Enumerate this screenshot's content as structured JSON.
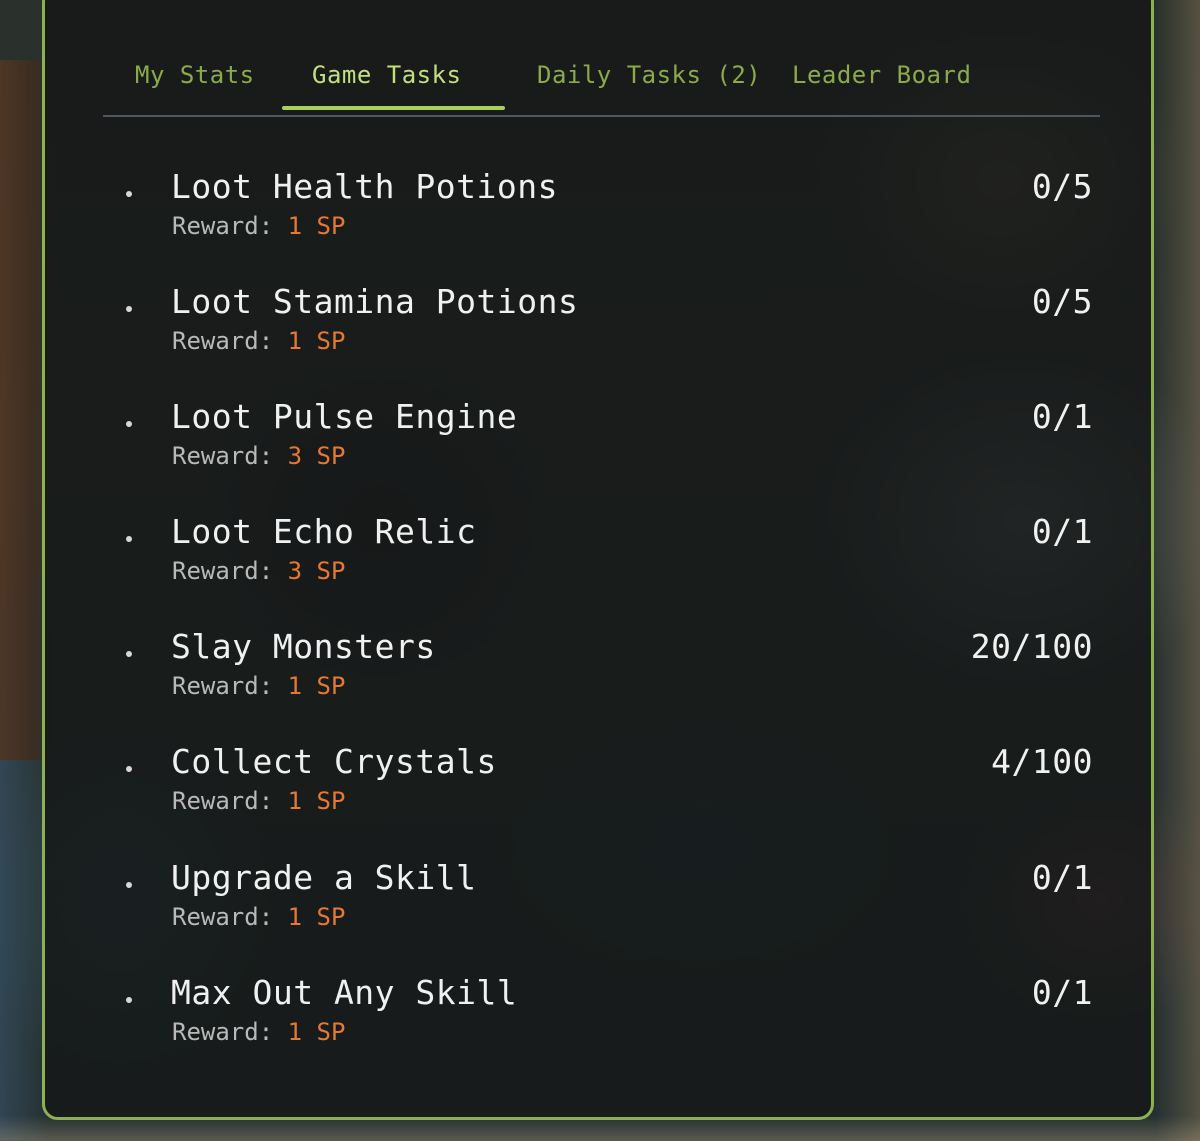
{
  "tabs": [
    {
      "label": "My Stats",
      "active": false
    },
    {
      "label": "Game Tasks",
      "active": true
    },
    {
      "label": "Daily Tasks (2)",
      "active": false
    },
    {
      "label": "Leader Board",
      "active": false
    }
  ],
  "reward_label": "Reward:",
  "tasks": [
    {
      "title": "Loot Health Potions",
      "reward": "1 SP",
      "progress": "0/5"
    },
    {
      "title": "Loot Stamina Potions",
      "reward": "1 SP",
      "progress": "0/5"
    },
    {
      "title": "Loot Pulse Engine",
      "reward": "3 SP",
      "progress": "0/1"
    },
    {
      "title": "Loot Echo Relic",
      "reward": "3 SP",
      "progress": "0/1"
    },
    {
      "title": "Slay Monsters",
      "reward": "1 SP",
      "progress": "20/100"
    },
    {
      "title": "Collect Crystals",
      "reward": "1 SP",
      "progress": "4/100"
    },
    {
      "title": "Upgrade a Skill",
      "reward": "1 SP",
      "progress": "0/1"
    },
    {
      "title": "Max Out Any Skill",
      "reward": "1 SP",
      "progress": "0/1"
    }
  ],
  "colors": {
    "panel_border": "#8bb152",
    "tab_text": "#8bab4a",
    "tab_active": "#c2e07a",
    "reward_value": "#e8782e",
    "text": "#f0f0f0"
  }
}
